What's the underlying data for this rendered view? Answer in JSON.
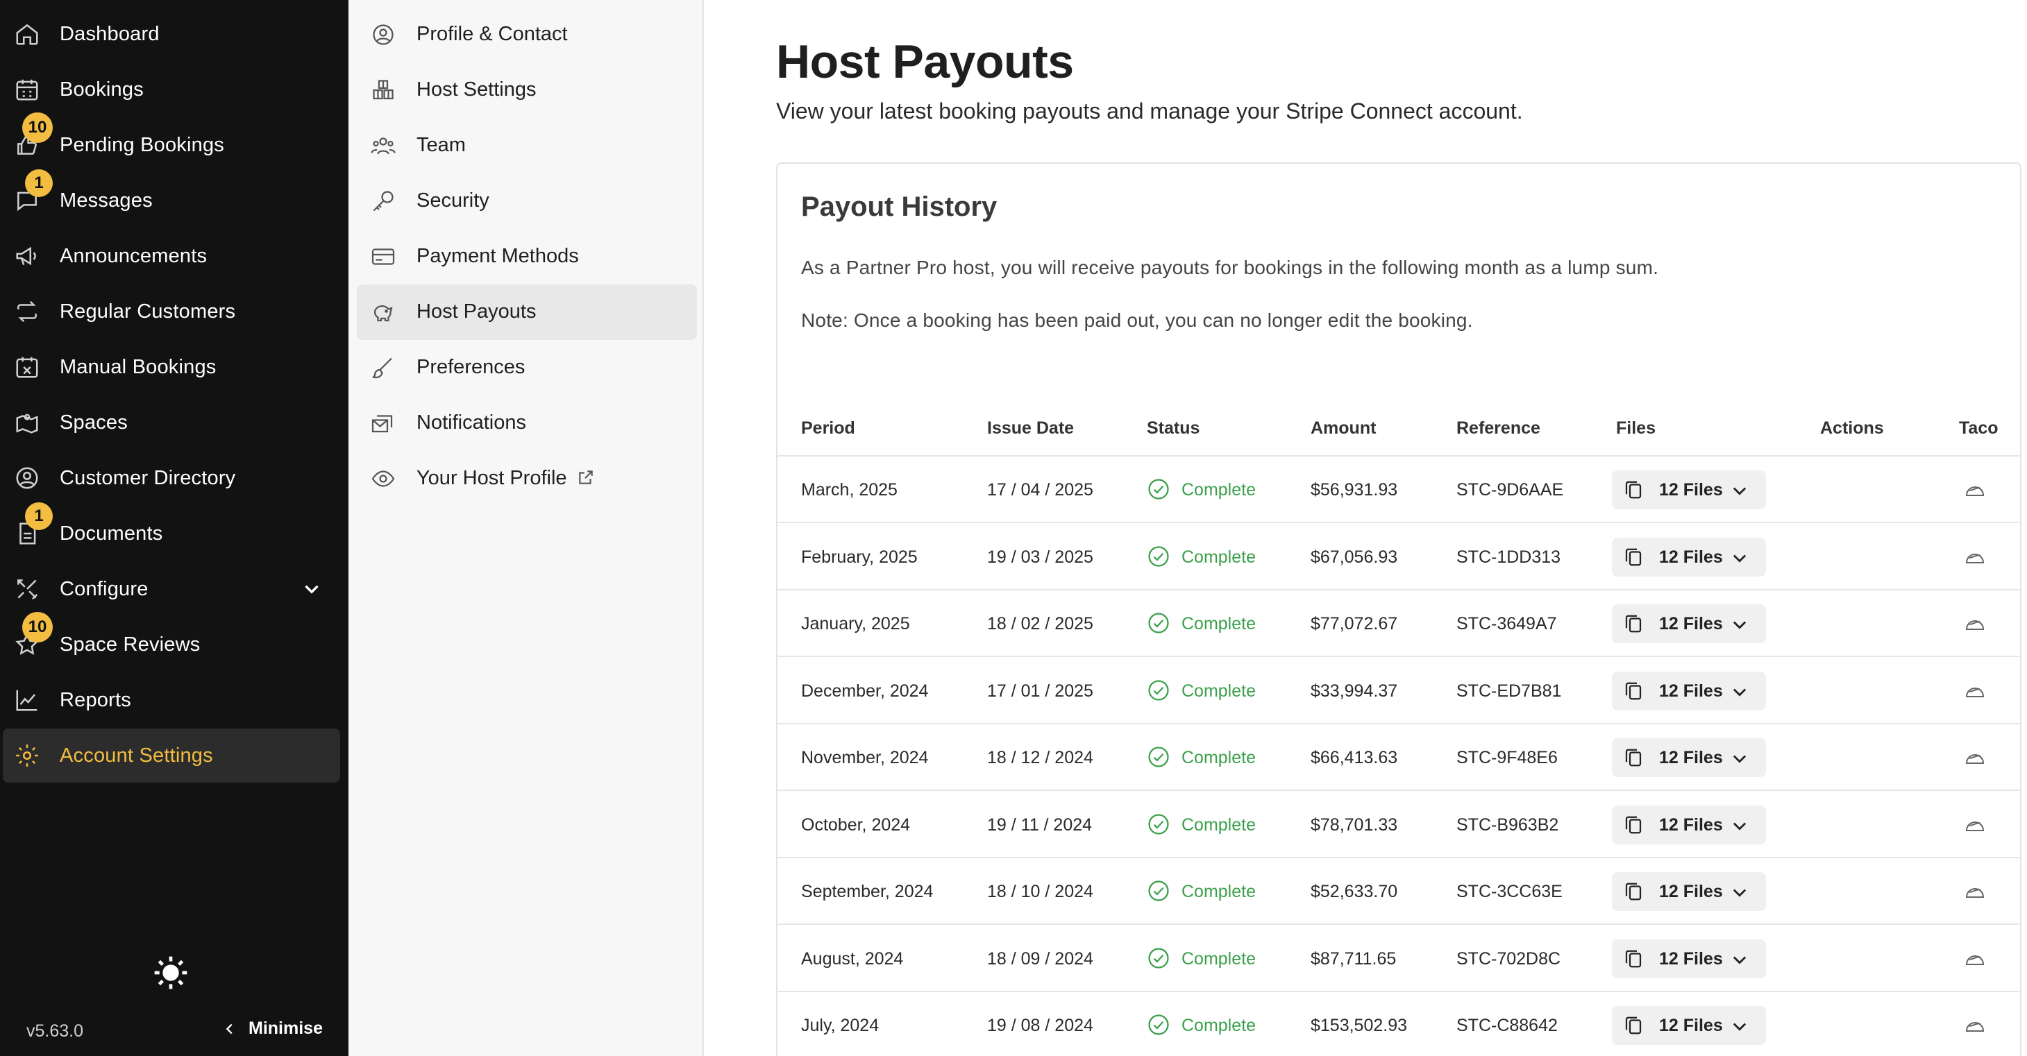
{
  "sidebar": {
    "items": [
      {
        "label": "Dashboard",
        "icon": "home-icon"
      },
      {
        "label": "Bookings",
        "icon": "calendar-icon"
      },
      {
        "label": "Pending Bookings",
        "icon": "thumbs-up-icon",
        "badge": "10"
      },
      {
        "label": "Messages",
        "icon": "chat-icon",
        "badge": "1"
      },
      {
        "label": "Announcements",
        "icon": "megaphone-icon"
      },
      {
        "label": "Regular Customers",
        "icon": "repeat-icon"
      },
      {
        "label": "Manual Bookings",
        "icon": "calendar-x-icon"
      },
      {
        "label": "Spaces",
        "icon": "map-icon"
      },
      {
        "label": "Customer Directory",
        "icon": "user-circle-icon"
      },
      {
        "label": "Documents",
        "icon": "document-icon",
        "badge": "1"
      },
      {
        "label": "Configure",
        "icon": "tools-icon"
      },
      {
        "label": "Space Reviews",
        "icon": "star-icon",
        "badge": "10"
      },
      {
        "label": "Reports",
        "icon": "chart-icon"
      },
      {
        "label": "Account Settings",
        "icon": "gear-icon"
      }
    ],
    "version": "v5.63.0",
    "minimise_label": "Minimise"
  },
  "settings_menu": {
    "items": [
      {
        "label": "Profile & Contact",
        "icon": "user-circle-icon"
      },
      {
        "label": "Host Settings",
        "icon": "boxes-icon"
      },
      {
        "label": "Team",
        "icon": "team-icon"
      },
      {
        "label": "Security",
        "icon": "key-icon"
      },
      {
        "label": "Payment Methods",
        "icon": "card-icon"
      },
      {
        "label": "Host Payouts",
        "icon": "piggy-bank-icon"
      },
      {
        "label": "Preferences",
        "icon": "brush-icon"
      },
      {
        "label": "Notifications",
        "icon": "mail-stack-icon"
      },
      {
        "label": "Your Host Profile",
        "icon": "eye-icon"
      }
    ]
  },
  "main": {
    "title": "Host Payouts",
    "subtitle": "View your latest booking payouts and manage your Stripe Connect account.",
    "card": {
      "title": "Payout History",
      "note1": "As a Partner Pro host, you will receive payouts for bookings in the following month as a lump sum.",
      "note2": "Note: Once a booking has been paid out, you can no longer edit the booking.",
      "columns": [
        "Period",
        "Issue Date",
        "Status",
        "Amount",
        "Reference",
        "Files",
        "Actions",
        "Taco"
      ],
      "rows": [
        {
          "period": "March, 2025",
          "issue_date": "17 / 04 / 2025",
          "status": "Complete",
          "amount": "$56,931.93",
          "reference": "STC-9D6AAE",
          "files": "12 Files"
        },
        {
          "period": "February, 2025",
          "issue_date": "19 / 03 / 2025",
          "status": "Complete",
          "amount": "$67,056.93",
          "reference": "STC-1DD313",
          "files": "12 Files"
        },
        {
          "period": "January, 2025",
          "issue_date": "18 / 02 / 2025",
          "status": "Complete",
          "amount": "$77,072.67",
          "reference": "STC-3649A7",
          "files": "12 Files"
        },
        {
          "period": "December, 2024",
          "issue_date": "17 / 01 / 2025",
          "status": "Complete",
          "amount": "$33,994.37",
          "reference": "STC-ED7B81",
          "files": "12 Files"
        },
        {
          "period": "November, 2024",
          "issue_date": "18 / 12 / 2024",
          "status": "Complete",
          "amount": "$66,413.63",
          "reference": "STC-9F48E6",
          "files": "12 Files"
        },
        {
          "period": "October, 2024",
          "issue_date": "19 / 11 / 2024",
          "status": "Complete",
          "amount": "$78,701.33",
          "reference": "STC-B963B2",
          "files": "12 Files"
        },
        {
          "period": "September, 2024",
          "issue_date": "18 / 10 / 2024",
          "status": "Complete",
          "amount": "$52,633.70",
          "reference": "STC-3CC63E",
          "files": "12 Files"
        },
        {
          "period": "August, 2024",
          "issue_date": "18 / 09 / 2024",
          "status": "Complete",
          "amount": "$87,711.65",
          "reference": "STC-702D8C",
          "files": "12 Files"
        },
        {
          "period": "July, 2024",
          "issue_date": "19 / 08 / 2024",
          "status": "Complete",
          "amount": "$153,502.93",
          "reference": "STC-C88642",
          "files": "12 Files"
        }
      ]
    }
  },
  "colors": {
    "accent": "#f3bd41",
    "sidebar_bg": "#121212",
    "status_complete": "#3aa04a"
  }
}
